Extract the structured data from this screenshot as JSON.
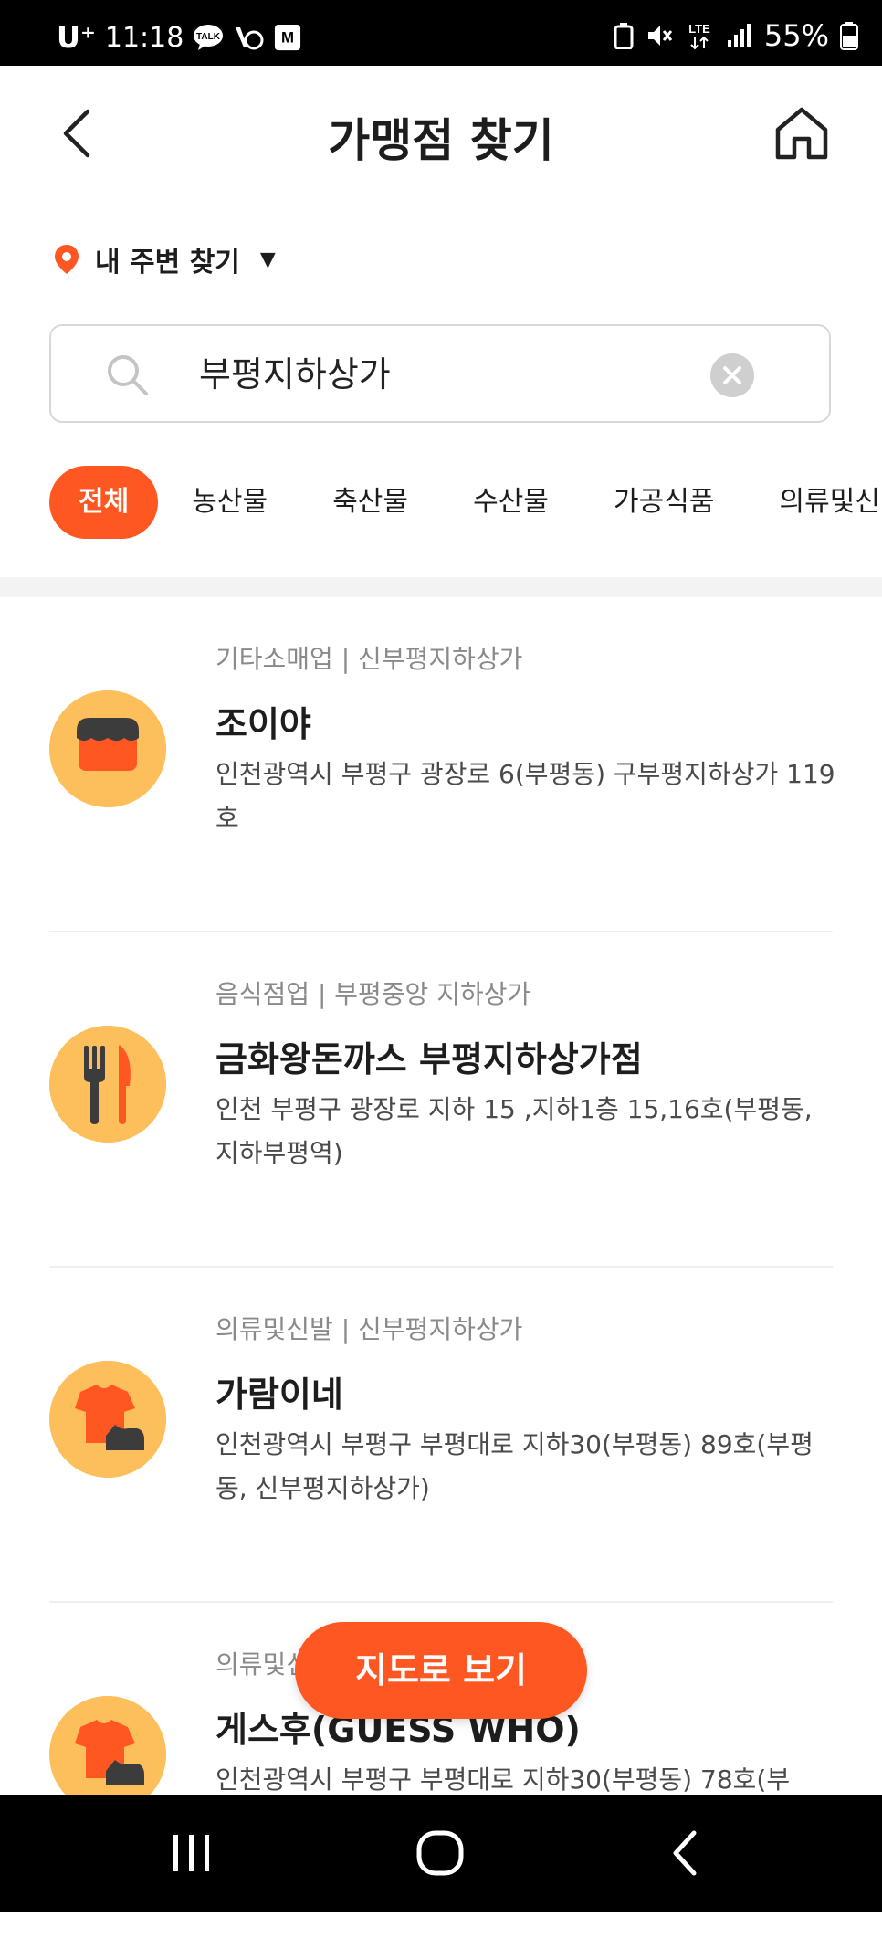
{
  "status_bar": {
    "carrier": "U⁺",
    "time": "11:18",
    "network": "LTE",
    "battery_pct": "55%",
    "left_icons": [
      "talk-icon",
      "vaccine-icon",
      "mstock-icon"
    ],
    "right_icons": [
      "recycle-icon",
      "mute-icon",
      "lte-icon",
      "signal-icon",
      "battery-icon"
    ],
    "talk_badge": "TALK",
    "mstock_badge": "M"
  },
  "header": {
    "title": "가맹점 찾기",
    "back_icon": "chevron-left-icon",
    "home_icon": "home-icon"
  },
  "location": {
    "label": "내 주변 찾기",
    "icon": "location-pin-icon",
    "caret": "▼"
  },
  "search": {
    "value": "부평지하상가",
    "icon": "search-icon",
    "clear_icon": "clear-icon"
  },
  "categories": [
    {
      "label": "전체",
      "active": true
    },
    {
      "label": "농산물",
      "active": false
    },
    {
      "label": "축산물",
      "active": false
    },
    {
      "label": "수산물",
      "active": false
    },
    {
      "label": "가공식품",
      "active": false
    },
    {
      "label": "의류및신발",
      "active": false
    }
  ],
  "stores": [
    {
      "category": "기타소매업 | 신부평지하상가",
      "name": "조이야",
      "address": "인천광역시 부평구 광장로 6(부평동) 구부평지하상가 119호",
      "icon": "shop-icon"
    },
    {
      "category": "음식점업 | 부평중앙 지하상가",
      "name": "금화왕돈까스 부평지하상가점",
      "address": "인천 부평구 광장로 지하 15 ,지하1층 15,16호(부평동, 지하부평역)",
      "icon": "fork-knife-icon"
    },
    {
      "category": "의류및신발 | 신부평지하상가",
      "name": "가람이네",
      "address": "인천광역시 부평구 부평대로 지하30(부평동) 89호(부평동, 신부평지하상가)",
      "icon": "clothing-shoe-icon"
    },
    {
      "category": "의류및신발 | 신부평지하상가",
      "name": "게스후(GUESS WHO)",
      "address": "인천광역시 부평구 부평대로 지하30(부평동) 78호(부",
      "icon": "clothing-shoe-icon"
    }
  ],
  "map_button": {
    "label": "지도로 보기"
  },
  "nav": {
    "icons": [
      "recent-apps-icon",
      "home-circle-icon",
      "back-icon"
    ]
  },
  "colors": {
    "accent": "#ff5722",
    "avatar_bg": "#fdbf5b",
    "dark": "#3c3c3c"
  }
}
